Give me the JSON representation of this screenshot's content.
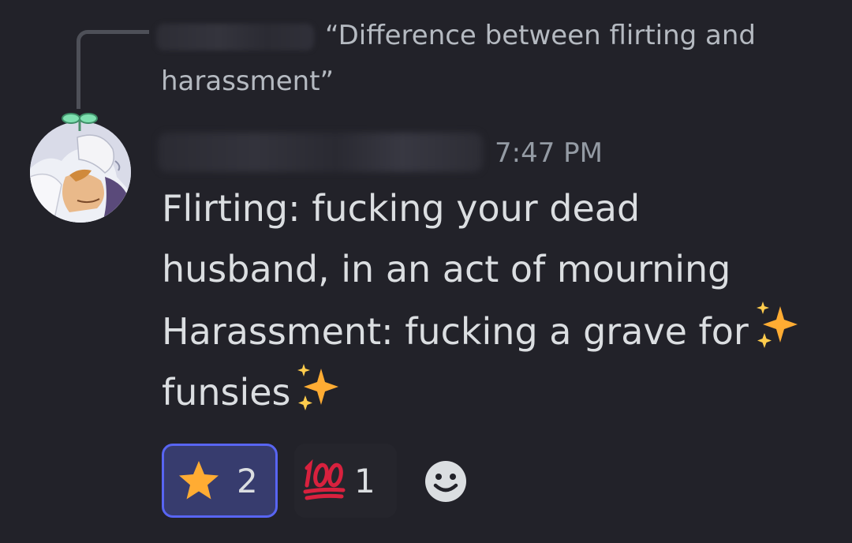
{
  "reply": {
    "quoted_text": "“Difference between flirting and harassment”"
  },
  "message": {
    "timestamp": "7:47 PM",
    "lines": [
      "Flirting: fucking your dead",
      "husband, in an act of mourning",
      "Harassment: fucking a grave for",
      "funsies"
    ],
    "sparkle_icon": "sparkles-emoji"
  },
  "reactions": [
    {
      "emoji": "star-emoji",
      "count": "2",
      "selected": true
    },
    {
      "emoji": "hundred-points-emoji",
      "count": "1",
      "selected": false
    }
  ],
  "add_reaction_icon": "add-reaction-smiley-icon",
  "colors": {
    "background": "#222229",
    "text": "#dbdee1",
    "muted": "#949ba4",
    "accent": "#5865f2",
    "reaction_active_bg": "#373c6e"
  }
}
